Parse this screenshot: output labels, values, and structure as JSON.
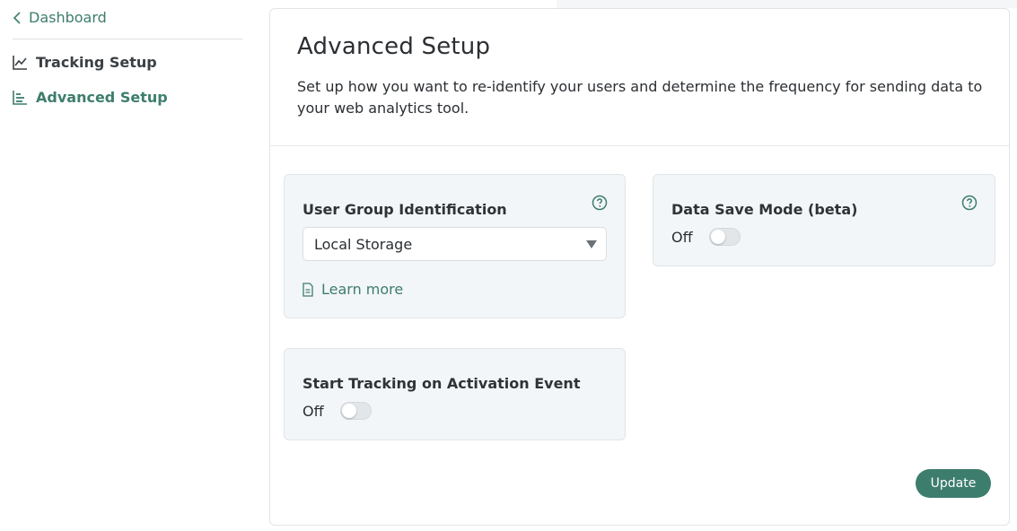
{
  "sidebar": {
    "back_label": "Dashboard",
    "items": [
      {
        "label": "Tracking Setup",
        "icon": "line-chart-icon",
        "active": false
      },
      {
        "label": "Advanced Setup",
        "icon": "bar-chart-icon",
        "active": true
      }
    ]
  },
  "header": {
    "title": "Advanced Setup",
    "description": "Set up how you want to re-identify your users and determine the frequency for sending data to your web analytics tool."
  },
  "cards": {
    "user_group": {
      "title": "User Group Identification",
      "selected_value": "Local Storage",
      "learn_more_label": "Learn more"
    },
    "data_save": {
      "title": "Data Save Mode (beta)",
      "toggle_label": "Off"
    },
    "activation": {
      "title": "Start Tracking on Activation Event",
      "toggle_label": "Off"
    }
  },
  "actions": {
    "update_label": "Update"
  },
  "colors": {
    "accent": "#3d7d6d",
    "card_bg": "#f3f6f8",
    "text": "#2b2f33"
  }
}
